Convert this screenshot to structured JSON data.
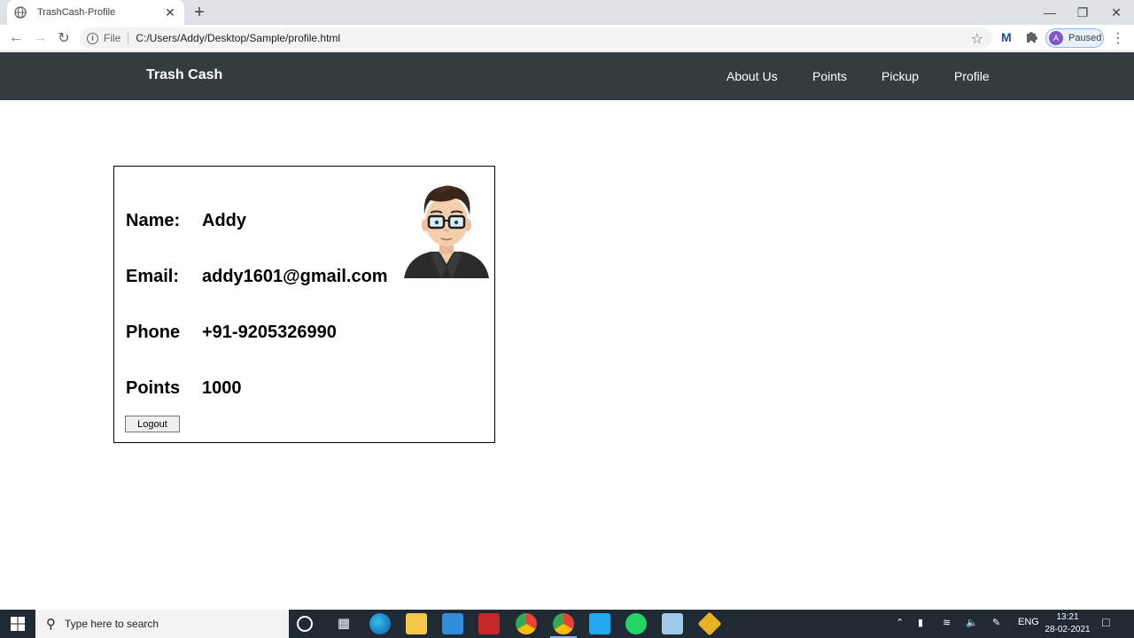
{
  "browser": {
    "tab_title": "TrashCash-Profile",
    "tab_close": "✕",
    "new_tab": "+",
    "scheme_label": "File",
    "url": "C:/Users/Addy/Desktop/Sample/profile.html",
    "profile_initial": "A",
    "profile_status": "Paused",
    "window_controls": {
      "minimize": "—",
      "restore": "❐",
      "close": "✕"
    }
  },
  "site": {
    "brand": "Trash Cash",
    "nav": [
      "About Us",
      "Points",
      "Pickup",
      "Profile"
    ]
  },
  "profile": {
    "name_label": "Name:",
    "name_value": "Addy",
    "email_label": "Email:",
    "email_value": "addy1601@gmail.com",
    "phone_label": "Phone",
    "phone_value": "+91-9205326990",
    "points_label": "Points",
    "points_value": "1000",
    "logout_label": "Logout"
  },
  "taskbar": {
    "search_placeholder": "Type here to search",
    "language": "ENG",
    "time": "13:21",
    "date": "28-02-2021"
  },
  "colors": {
    "navbar": "#333d3f",
    "taskbar": "#202a35",
    "tabstrip": "#dee1e6"
  }
}
